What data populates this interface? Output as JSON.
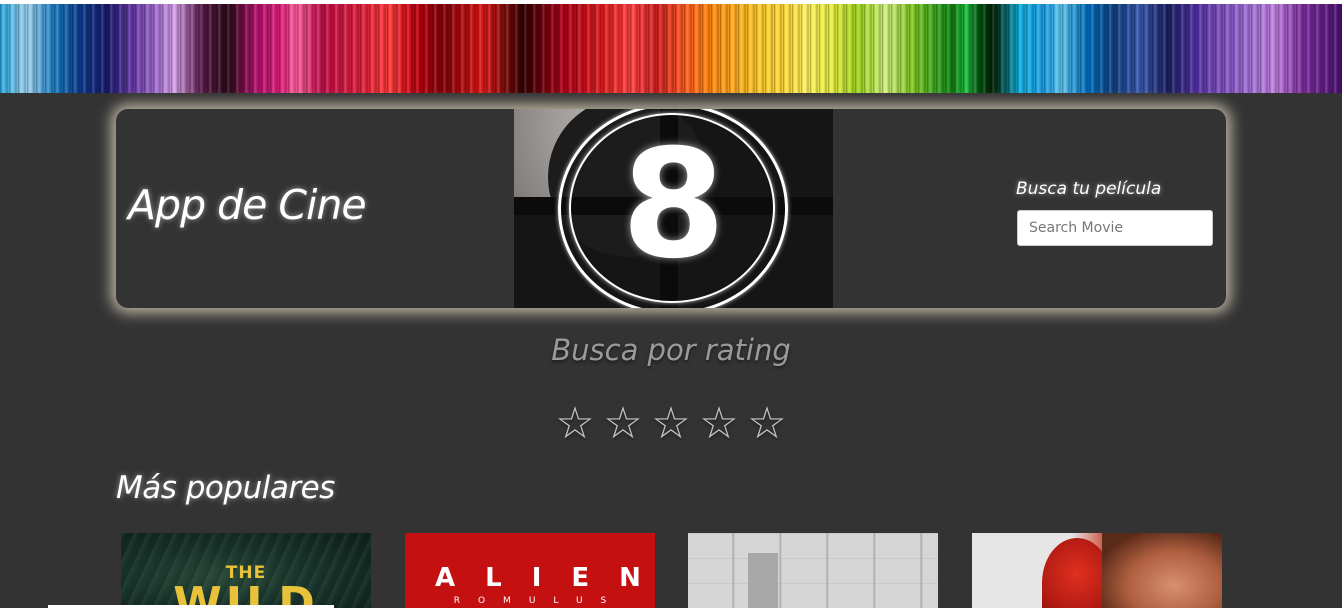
{
  "header": {
    "title": "App de Cine",
    "countdown_numeral": "8",
    "search_label": "Busca tu película",
    "search_placeholder": "Search Movie",
    "search_value": ""
  },
  "rating": {
    "heading": "Busca por rating",
    "stars": [
      "☆",
      "☆",
      "☆",
      "☆",
      "☆"
    ],
    "selected": 0
  },
  "popular": {
    "heading": "Más populares",
    "posters": [
      {
        "title_small": "THE",
        "title_big": "WILD"
      },
      {
        "title_big": "ALIEN",
        "subtitle": "ROMULUS"
      },
      {},
      {}
    ]
  },
  "icons": {
    "star": "star-outline-icon",
    "countdown": "film-countdown-icon"
  },
  "colors": {
    "background": "#333333",
    "header_glow": "#e8dec4",
    "star": "#c6c6c6",
    "rating_heading": "#9a9a9a"
  }
}
